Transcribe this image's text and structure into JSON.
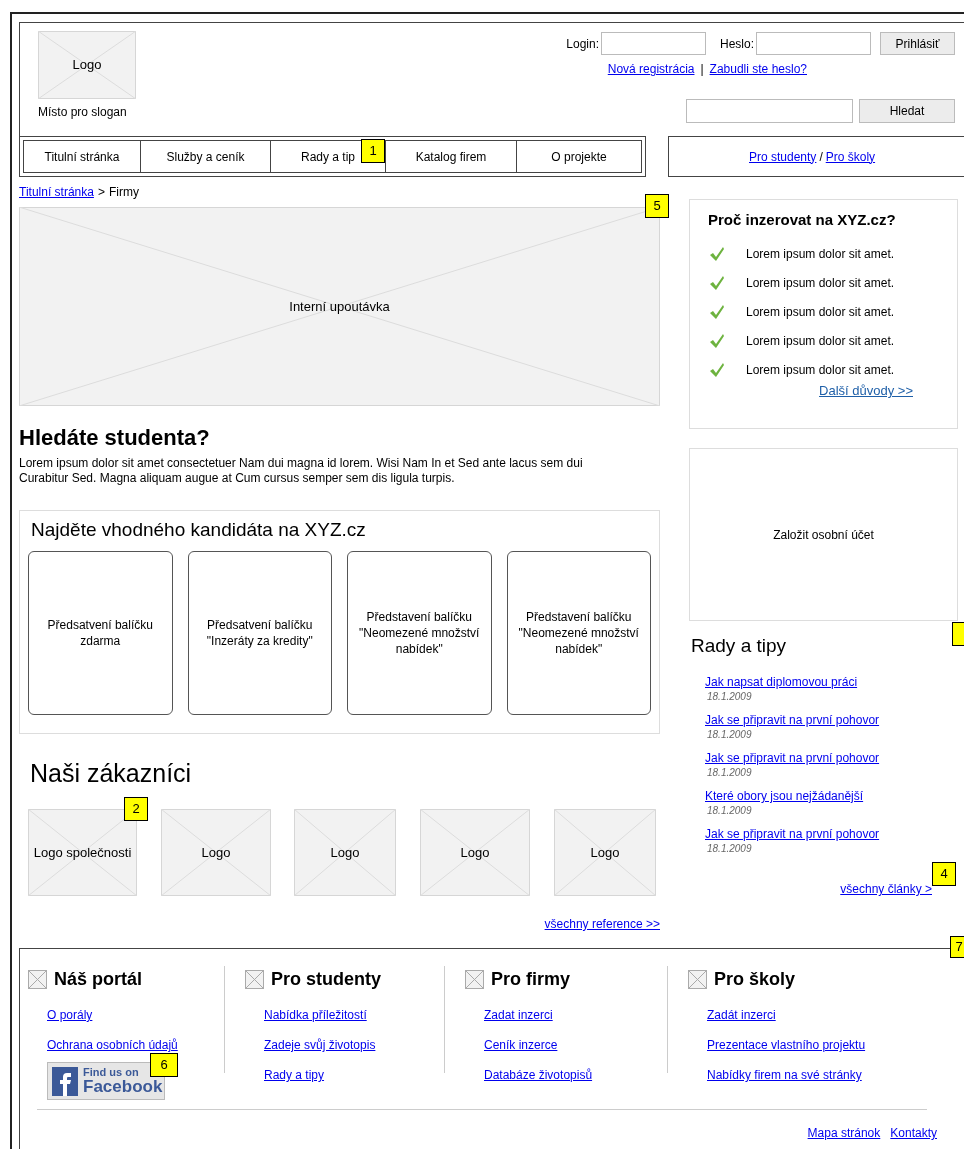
{
  "header": {
    "logo": "Logo",
    "slogan": "Místo pro slogan",
    "login_label": "Login:",
    "password_label": "Heslo:",
    "login_button": "Prihlásiť",
    "links": [
      "Nová registrácia",
      "Zabudli ste heslo?"
    ],
    "link_separator": "|",
    "search_button": "Hledat"
  },
  "nav": {
    "items": [
      {
        "label": "Titulní stránka"
      },
      {
        "label": "Služby a ceník"
      },
      {
        "label": "Rady a tip"
      },
      {
        "label": "Katalog firem"
      },
      {
        "label": "O projekte"
      }
    ]
  },
  "audience_links": {
    "items": [
      "Pro studenty",
      "Pro školy"
    ],
    "separator": "/"
  },
  "breadcrumb": {
    "link": "Titulní stránka",
    "separator": ">",
    "current": "Firmy"
  },
  "banner": {
    "label": "Interní upoutávka"
  },
  "intro": {
    "title": "Hledáte studenta?",
    "text": "Lorem ipsum dolor sit amet consectetuer Nam dui magna id lorem. Wisi Nam In et Sed ante lacus sem dui Curabitur Sed. Magna aliquam augue at Cum cursus semper sem dis ligula turpis."
  },
  "packages": {
    "title": "Najděte vhodného kandidáta na XYZ.cz",
    "cards": [
      {
        "line1": "Předsatvení balíčku",
        "line2": "zdarma"
      },
      {
        "line1": "Předsatvení balíčku",
        "line2": "\"Inzeráty za kredity\""
      },
      {
        "line1": "Představení balíčku",
        "line2": "\"Neomezené množství nabídek\""
      },
      {
        "line1": "Představení balíčku",
        "line2": "\"Neomezené množství nabídek\""
      }
    ]
  },
  "customers": {
    "title": "Naši zákazníci",
    "logos": [
      "Logo společnosti",
      "Logo",
      "Logo",
      "Logo",
      "Logo"
    ],
    "more_link": "všechny reference >>"
  },
  "why": {
    "title": "Proč inzerovat na XYZ.cz?",
    "items": [
      "Lorem ipsum dolor sit amet.",
      "Lorem ipsum dolor sit amet.",
      "Lorem ipsum dolor sit amet.",
      "Lorem ipsum dolor sit amet.",
      "Lorem ipsum dolor sit amet."
    ],
    "more_link": "Další důvody >>"
  },
  "account_box": {
    "label": "Založit osobní účet"
  },
  "tips": {
    "title": "Rady a tipy",
    "articles": [
      {
        "title": "Jak napsat diplomovou práci",
        "date": "18.1.2009"
      },
      {
        "title": "Jak se připravit na první pohovor",
        "date": "18.1.2009"
      },
      {
        "title": "Jak se připravit na první pohovor",
        "date": "18.1.2009"
      },
      {
        "title": "Které obory jsou nejžádanější",
        "date": "18.1.2009"
      },
      {
        "title": "Jak se připravit na první pohovor",
        "date": "18.1.2009"
      }
    ],
    "more_link": "všechny články >"
  },
  "footer": {
    "columns": [
      {
        "title": "Náš portál",
        "links": [
          "O porály",
          "Ochrana osobních údajů"
        ]
      },
      {
        "title": "Pro studenty",
        "links": [
          "Nabídka příležitostí",
          "Zadeje svůj životopis",
          "Rady a tipy"
        ]
      },
      {
        "title": "Pro firmy",
        "links": [
          "Zadat inzerci",
          "Ceník inzerce",
          "Databáze životopisů"
        ]
      },
      {
        "title": "Pro školy",
        "links": [
          "Zadát inzerci",
          "Prezentace vlastního projektu",
          "Nabídky firem na své stránky"
        ]
      }
    ],
    "facebook": {
      "line1": "Find us on",
      "line2": "Facebook"
    },
    "bottom_links": [
      "Mapa stránok",
      "Kontakty"
    ]
  },
  "annotations": [
    {
      "kind": "marker",
      "label": "1"
    },
    {
      "kind": "marker",
      "label": "5"
    },
    {
      "kind": "marker",
      "label": "2"
    },
    {
      "kind": "cut"
    },
    {
      "kind": "marker",
      "label": "4"
    },
    {
      "kind": "marker",
      "label": "6"
    },
    {
      "kind": "marker",
      "label": "7"
    }
  ]
}
